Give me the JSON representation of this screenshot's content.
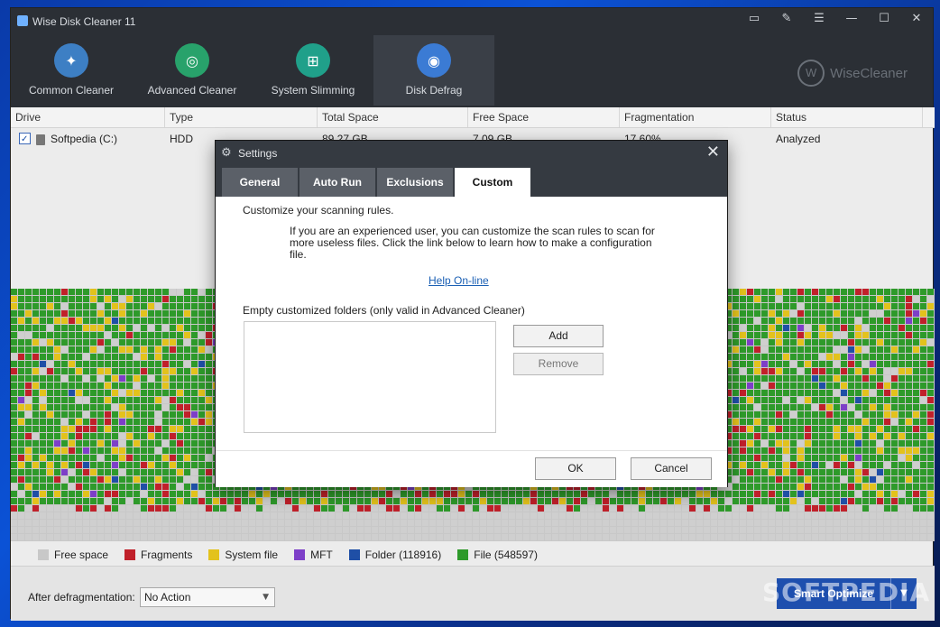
{
  "app": {
    "title": "Wise Disk Cleaner 11",
    "brand": "WiseCleaner"
  },
  "window_controls": [
    "feedback-icon",
    "notes-icon",
    "menu-icon",
    "minimize-icon",
    "maximize-icon",
    "close-icon"
  ],
  "nav": [
    {
      "label": "Common Cleaner",
      "icon": "broom-icon",
      "color": "#3d7fc4"
    },
    {
      "label": "Advanced Cleaner",
      "icon": "vacuum-icon",
      "color": "#28a26b"
    },
    {
      "label": "System Slimming",
      "icon": "windows-icon",
      "color": "#20a08a"
    },
    {
      "label": "Disk Defrag",
      "icon": "disk-icon",
      "color": "#3b7bd4",
      "active": true
    }
  ],
  "drives": {
    "columns": [
      "Drive",
      "Type",
      "Total Space",
      "Free Space",
      "Fragmentation",
      "Status"
    ],
    "rows": [
      {
        "drive": "Softpedia (C:)",
        "type": "HDD",
        "total": "89.27 GB",
        "free": "7.09 GB",
        "frag": "17.60%",
        "status": "Analyzed",
        "checked": true
      }
    ]
  },
  "legend": [
    {
      "label": "Free space",
      "color": "#c8c8c8"
    },
    {
      "label": "Fragments",
      "color": "#c0202a"
    },
    {
      "label": "System file",
      "color": "#e3c21c"
    },
    {
      "label": "MFT",
      "color": "#7d3fc8"
    },
    {
      "label": "Folder (118916)",
      "color": "#1f4fa6"
    },
    {
      "label": "File (548597)",
      "color": "#2e9a2a"
    }
  ],
  "footer": {
    "after_label": "After defragmentation:",
    "after_value": "No Action",
    "smart_label": "Smart Optimize"
  },
  "dialog": {
    "title": "Settings",
    "tabs": [
      "General",
      "Auto Run",
      "Exclusions",
      "Custom"
    ],
    "active_tab": "Custom",
    "intro": "Customize your scanning rules.",
    "description": "If you are an experienced user, you can customize the scan rules to scan for more useless files. Click the link below to learn how to make a configuration file.",
    "help_link": "Help On-line",
    "folders_label": "Empty customized folders (only valid in Advanced Cleaner)",
    "add_label": "Add",
    "remove_label": "Remove",
    "ok_label": "OK",
    "cancel_label": "Cancel"
  },
  "watermark": "SOFTPEDIA"
}
